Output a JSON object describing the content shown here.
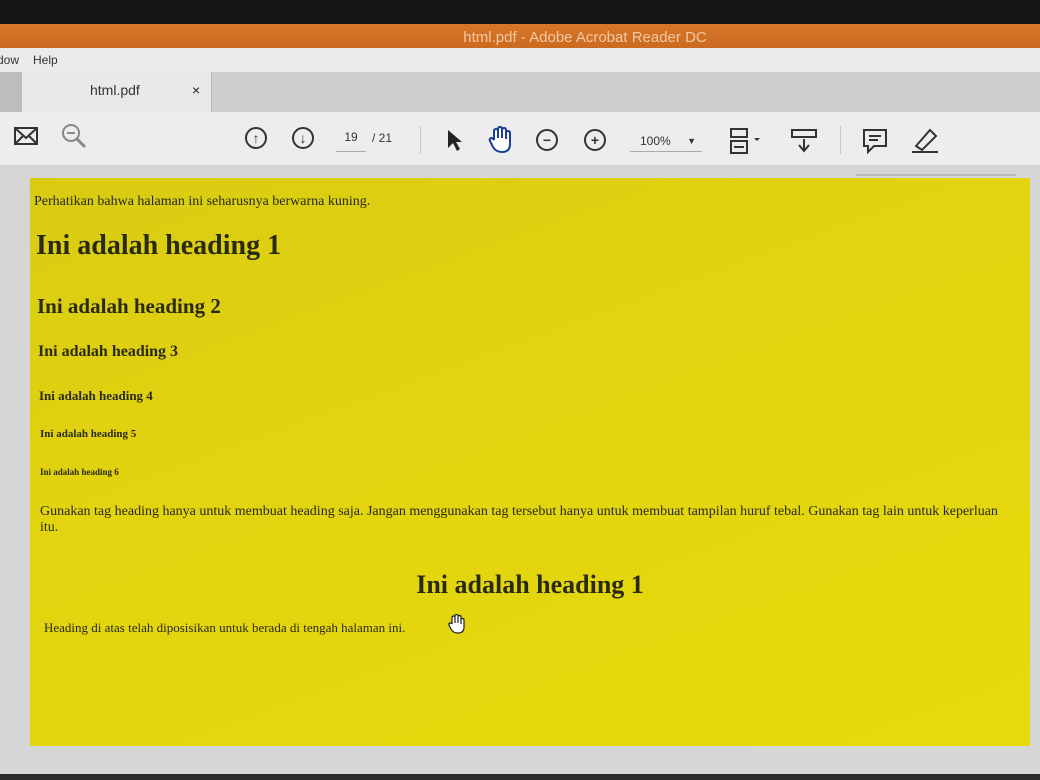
{
  "window": {
    "title": "html.pdf - Adobe Acrobat Reader DC"
  },
  "menu": {
    "items": [
      "dow",
      "Help"
    ]
  },
  "tab": {
    "label": "html.pdf",
    "close": "×"
  },
  "toolbar": {
    "page_current": "19",
    "page_total": "/ 21",
    "zoom": "100%"
  },
  "document": {
    "note": "Perhatikan bahwa halaman ini seharusnya berwarna kuning.",
    "h1": "Ini adalah heading 1",
    "h2": "Ini adalah heading 2",
    "h3": "Ini adalah heading 3",
    "h4": "Ini adalah heading 4",
    "h5": "Ini adalah heading 5",
    "h6": "Ini adalah heading 6",
    "paragraph": "Gunakan tag heading hanya untuk membuat heading saja. Jangan menggunakan tag tersebut hanya untuk membuat tampilan huruf tebal. Gunakan tag lain untuk keperluan itu.",
    "centered_heading": "Ini adalah heading 1",
    "centered_note": "Heading di atas telah diposisikan untuk berada di tengah halaman ini."
  },
  "colors": {
    "page_background": "#e2d40f",
    "titlebar": "#d8772a"
  }
}
